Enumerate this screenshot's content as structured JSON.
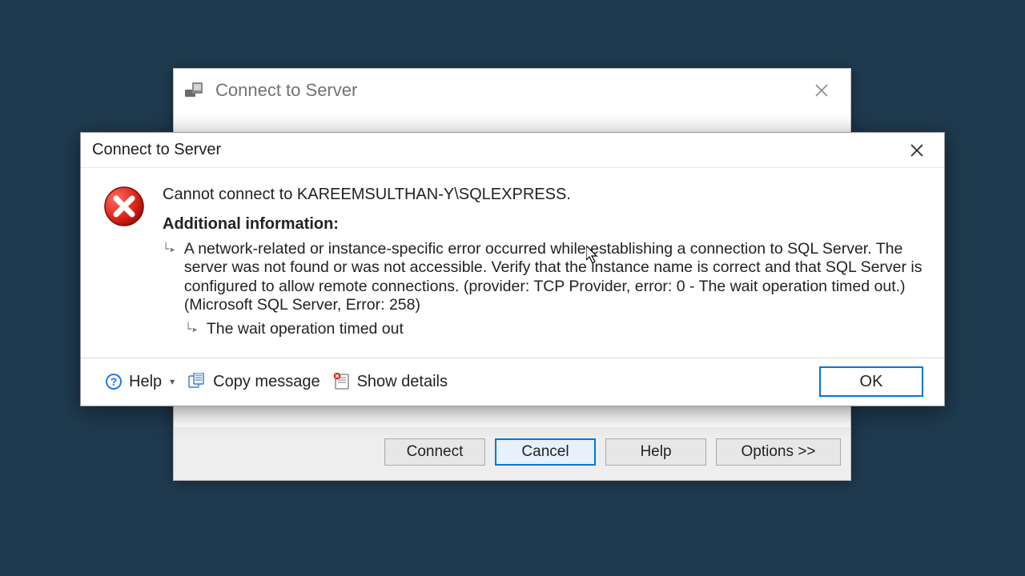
{
  "backWindow": {
    "title": "Connect to Server",
    "buttons": {
      "connect": "Connect",
      "cancel": "Cancel",
      "help": "Help",
      "options": "Options >>"
    }
  },
  "dialog": {
    "title": "Connect to Server",
    "headline": "Cannot connect to KAREEMSULTHAN-Y\\SQLEXPRESS.",
    "additionalInfoLabel": "Additional information:",
    "detail1": "A network-related or instance-specific error occurred while establishing a connection to SQL Server. The server was not found or was not accessible. Verify that the instance name is correct and that SQL Server is configured to allow remote connections. (provider: TCP Provider, error: 0 - The wait operation timed out.) (Microsoft SQL Server, Error: 258)",
    "detail2": "The wait operation timed out",
    "footer": {
      "help": "Help",
      "copy": "Copy message",
      "show": "Show details",
      "ok": "OK"
    }
  }
}
